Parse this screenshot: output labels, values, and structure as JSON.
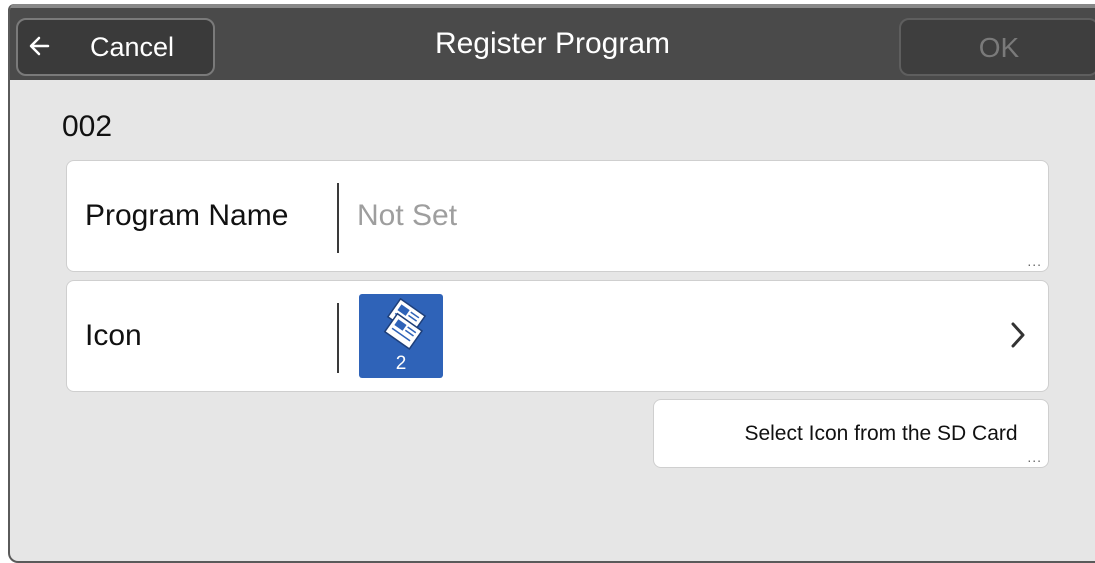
{
  "header": {
    "back_label": "Cancel",
    "title": "Register Program",
    "ok_label": "OK"
  },
  "program": {
    "number": "002"
  },
  "fields": {
    "program_name": {
      "label": "Program Name",
      "value": "Not Set",
      "more": "..."
    },
    "icon": {
      "label": "Icon",
      "icon_name": "copy-icon",
      "icon_number": "2",
      "icon_color": "#2f63b8"
    }
  },
  "actions": {
    "sd_card_label": "Select Icon from the SD Card",
    "more": "..."
  }
}
